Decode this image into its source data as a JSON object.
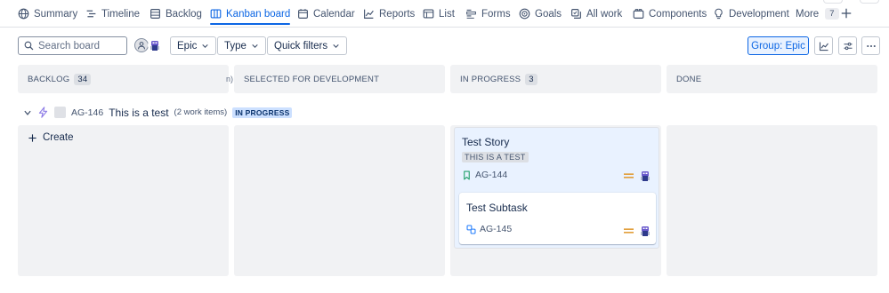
{
  "nav": {
    "tabs": [
      {
        "label": "Summary",
        "icon": "globe-icon",
        "active": false
      },
      {
        "label": "Timeline",
        "icon": "timeline-icon",
        "active": false
      },
      {
        "label": "Backlog",
        "icon": "backlog-icon",
        "active": false
      },
      {
        "label": "Kanban board",
        "icon": "board-icon",
        "active": true
      },
      {
        "label": "Calendar",
        "icon": "calendar-icon",
        "active": false
      },
      {
        "label": "Reports",
        "icon": "chart-icon",
        "active": false
      },
      {
        "label": "List",
        "icon": "list-icon",
        "active": false
      },
      {
        "label": "Forms",
        "icon": "forms-icon",
        "active": false
      },
      {
        "label": "Goals",
        "icon": "target-icon",
        "active": false
      },
      {
        "label": "All work",
        "icon": "all-work-icon",
        "active": false
      },
      {
        "label": "Components",
        "icon": "components-icon",
        "active": false
      },
      {
        "label": "Development",
        "icon": "lightbulb-icon",
        "active": false
      }
    ],
    "more_label": "More",
    "more_count": "7",
    "accent": "#0c66e4"
  },
  "toolbar": {
    "search_placeholder": "Search board",
    "epic_label": "Epic",
    "type_label": "Type",
    "quick_filters_label": "Quick filters",
    "group_label": "Group: Epic"
  },
  "columns": [
    {
      "name": "BACKLOG",
      "count": "34"
    },
    {
      "name": "SELECTED FOR DEVELOPMENT",
      "count": ""
    },
    {
      "name": "IN PROGRESS",
      "count": "3"
    },
    {
      "name": "DONE",
      "count": ""
    }
  ],
  "clipped_fragment": "n)",
  "swimlane": {
    "key": "AG-146",
    "title": "This is a test",
    "count": "(2 work items)",
    "status": "IN PROGRESS"
  },
  "create_label": "Create",
  "cards": {
    "parent": {
      "title": "Test Story",
      "epic": "THIS IS A TEST",
      "key": "AG-144",
      "type_icon": "story-bookmark-icon",
      "priority": "medium-priority-icon"
    },
    "subtask": {
      "title": "Test Subtask",
      "key": "AG-145",
      "type_icon": "subtask-icon",
      "priority": "medium-priority-icon"
    }
  },
  "colors": {
    "column_bg": "#f1f2f4",
    "parent_card_bg": "#e9f2ff",
    "priority_medium": "#e2a03f",
    "story_green": "#22a06b",
    "epic_purple": "#8f7ee7",
    "subtask_blue": "#1d7afc"
  }
}
